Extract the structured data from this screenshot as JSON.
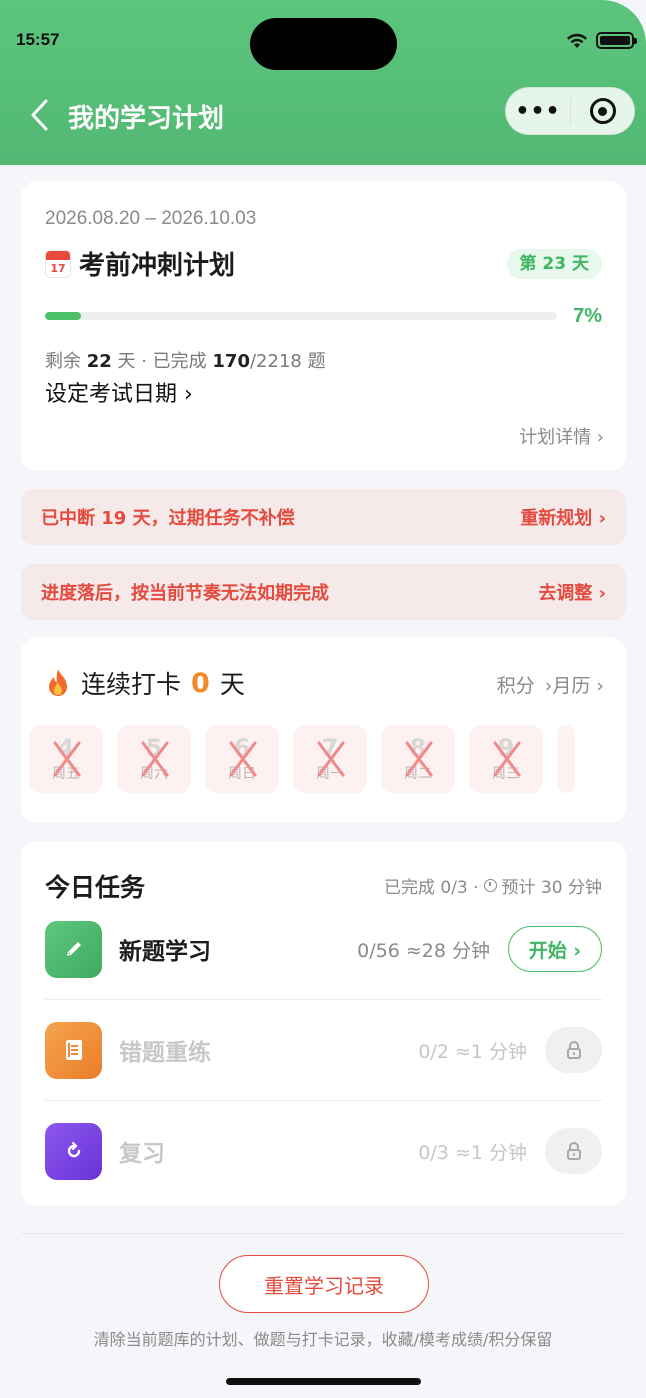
{
  "status_bar": {
    "time": "15:57"
  },
  "nav": {
    "title": "我的学习计划",
    "more_label": "•••"
  },
  "plan": {
    "date_range": "2026.08.20 – 2026.10.03",
    "calendar_day": "17",
    "name": "考前冲刺计划",
    "day_badge": "第 23 天",
    "progress_fraction": 0.07,
    "progress_label": "7%",
    "stats": {
      "remaining_prefix": "剩余 ",
      "remaining_days": "22",
      "mid": " 天 · 已完成 ",
      "done": "170",
      "total": "/2218",
      "suffix": " 题"
    },
    "exam_link": "设定考试日期 ›",
    "detail_link": "计划详情 ›"
  },
  "alerts": [
    {
      "message": "已中断 19 天，过期任务不补偿",
      "action": "重新规划 ›"
    },
    {
      "message": "进度落后，按当前节奏无法如期完成",
      "action": "去调整 ›"
    }
  ],
  "streak": {
    "label_prefix": "连续打卡",
    "count": "0",
    "label_suffix": "天",
    "links": [
      "积分",
      "›月历 ›"
    ],
    "days": [
      {
        "num": "4",
        "name": "周五"
      },
      {
        "num": "5",
        "name": "周六"
      },
      {
        "num": "6",
        "name": "周日"
      },
      {
        "num": "7",
        "name": "周一"
      },
      {
        "num": "8",
        "name": "周二"
      },
      {
        "num": "9",
        "name": "周三"
      }
    ]
  },
  "tasks": {
    "title": "今日任务",
    "summary_done": "已完成 0/3 ·",
    "summary_eta": "预计 30 分钟",
    "items": [
      {
        "name": "新题学习",
        "meta": "0/56 ≈28 分钟",
        "icon": "pencil-icon",
        "action": "开始 ›",
        "locked": false
      },
      {
        "name": "错题重练",
        "meta": "0/2 ≈1 分钟",
        "icon": "note-icon",
        "locked": true
      },
      {
        "name": "复习",
        "meta": "0/3 ≈1 分钟",
        "icon": "refresh-icon",
        "locked": true
      }
    ]
  },
  "reset": {
    "button_label": "重置学习记录",
    "note": "清除当前题库的计划、做题与打卡记录，收藏/模考成绩/积分保留"
  },
  "colors": {
    "brand_green": "#52b873",
    "alert_red": "#e44b3f",
    "streak_orange": "#f28a2a"
  }
}
